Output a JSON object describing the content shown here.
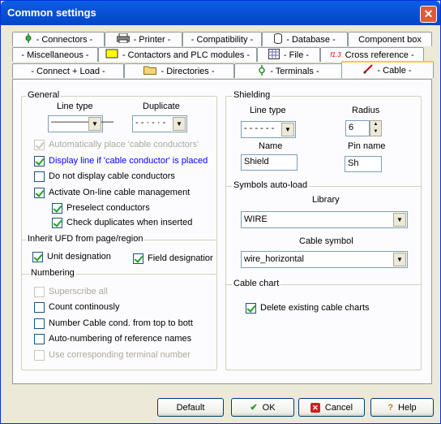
{
  "window": {
    "title": "Common settings",
    "close_icon": "close-icon"
  },
  "tabs": {
    "row1": [
      {
        "label": "- Connectors -",
        "icon": "connector-icon"
      },
      {
        "label": "- Printer -",
        "icon": "printer-icon"
      },
      {
        "label": "- Compatibility -",
        "icon": ""
      },
      {
        "label": "- Database -",
        "icon": "database-icon"
      },
      {
        "label": "Component box",
        "icon": ""
      }
    ],
    "row2": [
      {
        "label": "- Miscellaneous -",
        "icon": ""
      },
      {
        "label": "- Contactors and PLC modules -",
        "icon": "contactor-icon"
      },
      {
        "label": "- File -",
        "icon": "file-grid-icon"
      },
      {
        "label": "Cross reference -",
        "icon": "cross-reference-icon"
      }
    ],
    "row3": [
      {
        "label": "- Connect + Load -",
        "icon": ""
      },
      {
        "label": "- Directories -",
        "icon": "folder-icon"
      },
      {
        "label": "- Terminals -",
        "icon": "terminal-icon"
      },
      {
        "label": "- Cable -",
        "icon": "cable-icon"
      }
    ],
    "cross_ref_badge": "f1.3"
  },
  "general": {
    "legend": "General",
    "line_type_label": "Line type",
    "duplicate_label": "Duplicate",
    "line_type_value": "———————",
    "duplicate_value": "- - · - · -",
    "checks": [
      {
        "label": "Automatically place 'cable conductors'",
        "checked": true,
        "disabled": true
      },
      {
        "label": "Display line if 'cable conductor' is placed",
        "checked": true,
        "disabled": false
      },
      {
        "label": "Do not display cable conductors",
        "checked": false,
        "disabled": false
      },
      {
        "label": "Activate On-line cable management",
        "checked": true,
        "disabled": false
      },
      {
        "label": "Preselect conductors",
        "checked": true,
        "disabled": false
      },
      {
        "label": "Check duplicates when inserted",
        "checked": true,
        "disabled": false
      }
    ]
  },
  "inherit": {
    "legend": "Inherit UFD from page/region",
    "unit_designation": "Unit designation",
    "field_designation": "Field designatior"
  },
  "numbering": {
    "legend": "Numbering",
    "checks": [
      {
        "label": "Superscribe all",
        "checked": false,
        "disabled": true
      },
      {
        "label": "Count continously",
        "checked": false,
        "disabled": false
      },
      {
        "label": "Number Cable cond. from top to bott",
        "checked": false,
        "disabled": false
      },
      {
        "label": "Auto-numbering of reference names",
        "checked": false,
        "disabled": false
      },
      {
        "label": "Use corresponding terminal number",
        "checked": false,
        "disabled": true
      }
    ]
  },
  "shielding": {
    "legend": "Shielding",
    "line_type_label": "Line type",
    "line_type_value": "- - - - - -",
    "radius_label": "Radius",
    "radius_value": "6",
    "name_label": "Name",
    "name_value": "Shield",
    "pin_name_label": "Pin name",
    "pin_name_value": "Sh"
  },
  "symbols": {
    "legend": "Symbols auto-load",
    "library_label": "Library",
    "library_value": "WIRE",
    "cable_symbol_label": "Cable symbol",
    "cable_symbol_value": "wire_horizontal"
  },
  "cable_chart": {
    "legend": "Cable chart",
    "delete_label": "Delete existing cable charts"
  },
  "buttons": {
    "default": "Default",
    "ok": "OK",
    "cancel": "Cancel",
    "help": "Help"
  }
}
